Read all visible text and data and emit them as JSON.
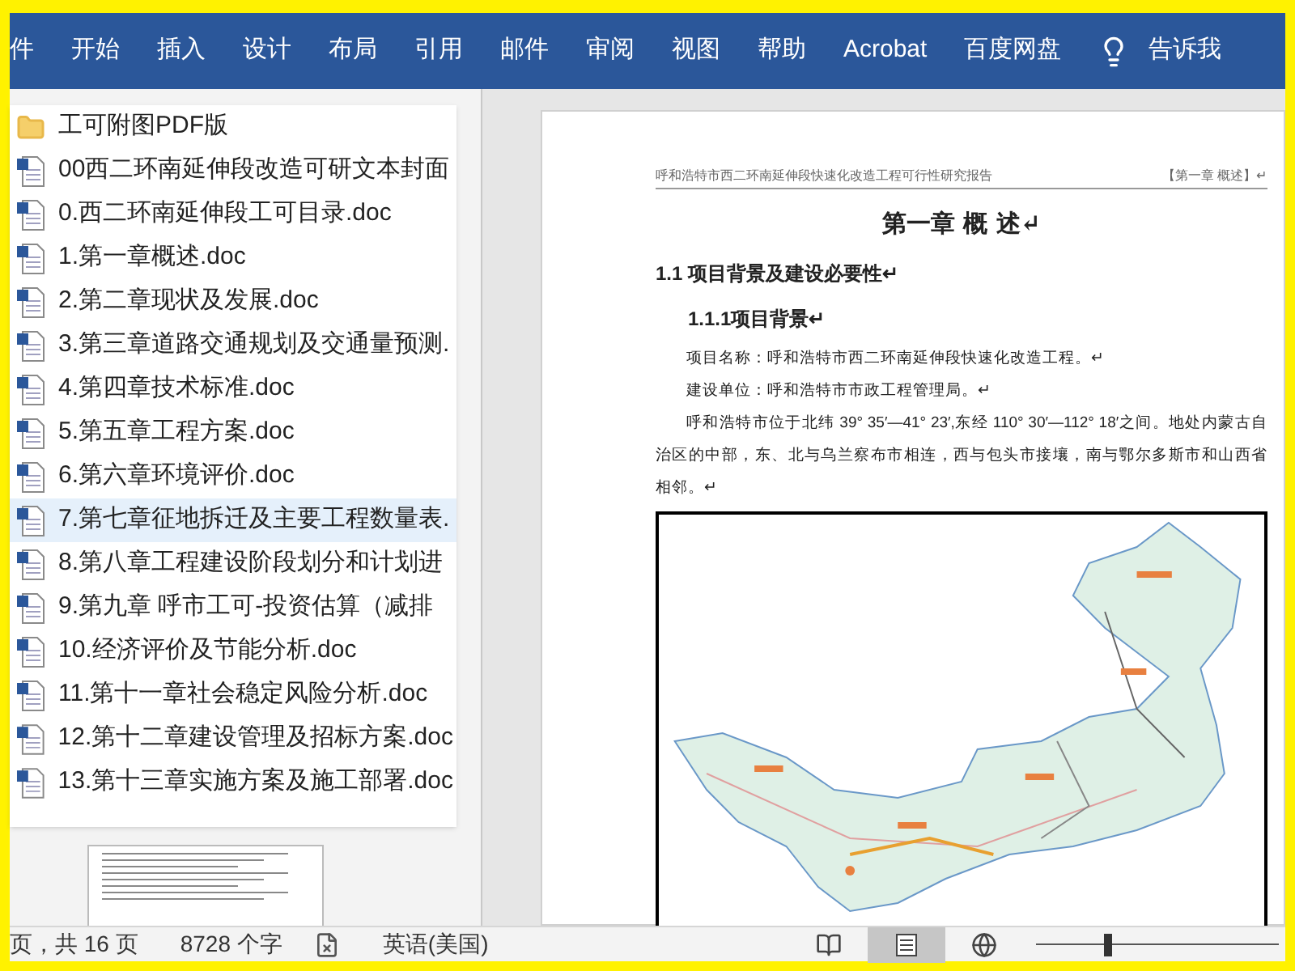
{
  "ribbon": {
    "tabs": [
      {
        "label": "件",
        "selected": false
      },
      {
        "label": "开始",
        "selected": false
      },
      {
        "label": "插入",
        "selected": false
      },
      {
        "label": "设计",
        "selected": false
      },
      {
        "label": "布局",
        "selected": false
      },
      {
        "label": "引用",
        "selected": false
      },
      {
        "label": "邮件",
        "selected": false
      },
      {
        "label": "审阅",
        "selected": false
      },
      {
        "label": "视图",
        "selected": false
      },
      {
        "label": "帮助",
        "selected": false
      },
      {
        "label": "Acrobat",
        "selected": false
      },
      {
        "label": "百度网盘",
        "selected": false
      }
    ],
    "tell_me": "告诉我"
  },
  "file_list": [
    {
      "kind": "folder",
      "name": "工可附图PDF版",
      "selected": false
    },
    {
      "kind": "doc",
      "name": "00西二环南延伸段改造可研文本封面",
      "selected": false
    },
    {
      "kind": "doc",
      "name": "0.西二环南延伸段工可目录.doc",
      "selected": false
    },
    {
      "kind": "doc",
      "name": "1.第一章概述.doc",
      "selected": false
    },
    {
      "kind": "doc",
      "name": "2.第二章现状及发展.doc",
      "selected": false
    },
    {
      "kind": "doc",
      "name": "3.第三章道路交通规划及交通量预测.",
      "selected": false
    },
    {
      "kind": "doc",
      "name": "4.第四章技术标准.doc",
      "selected": false
    },
    {
      "kind": "doc",
      "name": "5.第五章工程方案.doc",
      "selected": false
    },
    {
      "kind": "doc",
      "name": "6.第六章环境评价.doc",
      "selected": false
    },
    {
      "kind": "doc",
      "name": "7.第七章征地拆迁及主要工程数量表.",
      "selected": true
    },
    {
      "kind": "doc",
      "name": "8.第八章工程建设阶段划分和计划进",
      "selected": false
    },
    {
      "kind": "doc",
      "name": "9.第九章 呼市工可-投资估算（减排",
      "selected": false
    },
    {
      "kind": "doc",
      "name": "10.经济评价及节能分析.doc",
      "selected": false
    },
    {
      "kind": "doc",
      "name": "11.第十一章社会稳定风险分析.doc",
      "selected": false
    },
    {
      "kind": "doc",
      "name": "12.第十二章建设管理及招标方案.doc",
      "selected": false
    },
    {
      "kind": "doc",
      "name": "13.第十三章实施方案及施工部署.doc",
      "selected": false
    }
  ],
  "document": {
    "header_left": "呼和浩特市西二环南延伸段快速化改造工程可行性研究报告",
    "header_right": "【第一章 概述】↵",
    "chapter_title": "第一章 概 述↵",
    "section_title": "1.1 项目背景及建设必要性↵",
    "subsection_title": "1.1.1项目背景↵",
    "paragraphs": [
      "项目名称：呼和浩特市西二环南延伸段快速化改造工程。↵",
      "建设单位：呼和浩特市市政工程管理局。↵",
      "呼和浩特市位于北纬 39° 35′—41° 23′,东经 110° 30′—112° 18′之间。地处内蒙古自治区的中部，东、北与乌兰察布市相连，西与包头市接壤，南与鄂尔多斯市和山西省相邻。↵"
    ]
  },
  "status_bar": {
    "page": "页，共 16 页",
    "words": "8728 个字",
    "language": "英语(美国)",
    "views": [
      {
        "kind": "read",
        "selected": false
      },
      {
        "kind": "print",
        "selected": true
      },
      {
        "kind": "web",
        "selected": false
      }
    ],
    "zoom": {
      "level": 0.28
    }
  }
}
